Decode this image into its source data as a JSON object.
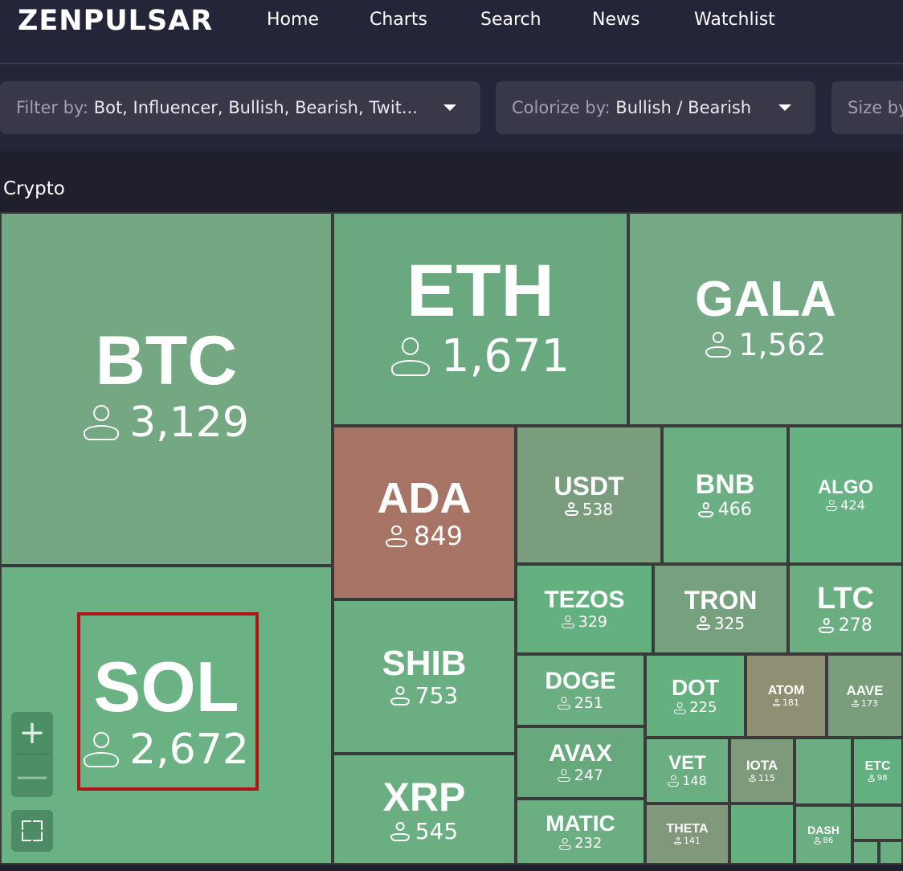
{
  "app": {
    "logo": "ZENPULSAR"
  },
  "nav": [
    {
      "label": "Home"
    },
    {
      "label": "Charts"
    },
    {
      "label": "Search"
    },
    {
      "label": "News"
    },
    {
      "label": "Watchlist"
    }
  ],
  "filters": {
    "filter_by": {
      "label": "Filter by:",
      "value": "Bot, Influencer, Bullish, Bearish, Twit..."
    },
    "colorize_by": {
      "label": "Colorize by:",
      "value": "Bullish / Bearish"
    },
    "size_by": {
      "label": "Size by",
      "value": ""
    }
  },
  "section": {
    "title": "Crypto"
  },
  "colors": {
    "bullish": "#6aae82",
    "bearish": "#a87466",
    "neutral": "#8f8f74"
  },
  "tiles": [
    {
      "symbol": "BTC",
      "count": "3,129",
      "color": "#73a882"
    },
    {
      "symbol": "ETH",
      "count": "1,671",
      "color": "#6aa97f"
    },
    {
      "symbol": "GALA",
      "count": "1,562",
      "color": "#75a985"
    },
    {
      "symbol": "SOL",
      "count": "2,672",
      "color": "#6ab183"
    },
    {
      "symbol": "ADA",
      "count": "849",
      "color": "#a87466"
    },
    {
      "symbol": "USDT",
      "count": "538",
      "color": "#799d7d"
    },
    {
      "symbol": "BNB",
      "count": "466",
      "color": "#6aae82"
    },
    {
      "symbol": "ALGO",
      "count": "424",
      "color": "#67b282"
    },
    {
      "symbol": "SHIB",
      "count": "753",
      "color": "#6aae82"
    },
    {
      "symbol": "XRP",
      "count": "545",
      "color": "#6aae82"
    },
    {
      "symbol": "TEZOS",
      "count": "329",
      "color": "#64b07f"
    },
    {
      "symbol": "TRON",
      "count": "325",
      "color": "#76a07e"
    },
    {
      "symbol": "LTC",
      "count": "278",
      "color": "#6aae82"
    },
    {
      "symbol": "DOGE",
      "count": "251",
      "color": "#6aae82"
    },
    {
      "symbol": "DOT",
      "count": "225",
      "color": "#64b07f"
    },
    {
      "symbol": "ATOM",
      "count": "181",
      "color": "#8f8f74"
    },
    {
      "symbol": "AAVE",
      "count": "173",
      "color": "#7a9e7c"
    },
    {
      "symbol": "AVAX",
      "count": "247",
      "color": "#67a97d"
    },
    {
      "symbol": "MATIC",
      "count": "232",
      "color": "#6aae82"
    },
    {
      "symbol": "VET",
      "count": "148",
      "color": "#6aae82"
    },
    {
      "symbol": "IOTA",
      "count": "115",
      "color": "#7d9a7a"
    },
    {
      "symbol": "ETC",
      "count": "98",
      "color": "#62b07f"
    },
    {
      "symbol": "THETA",
      "count": "141",
      "color": "#82987a"
    },
    {
      "symbol": "DASH",
      "count": "86",
      "color": "#6aae82"
    }
  ],
  "controls": {
    "zoom_in": "+",
    "zoom_out": "—"
  }
}
